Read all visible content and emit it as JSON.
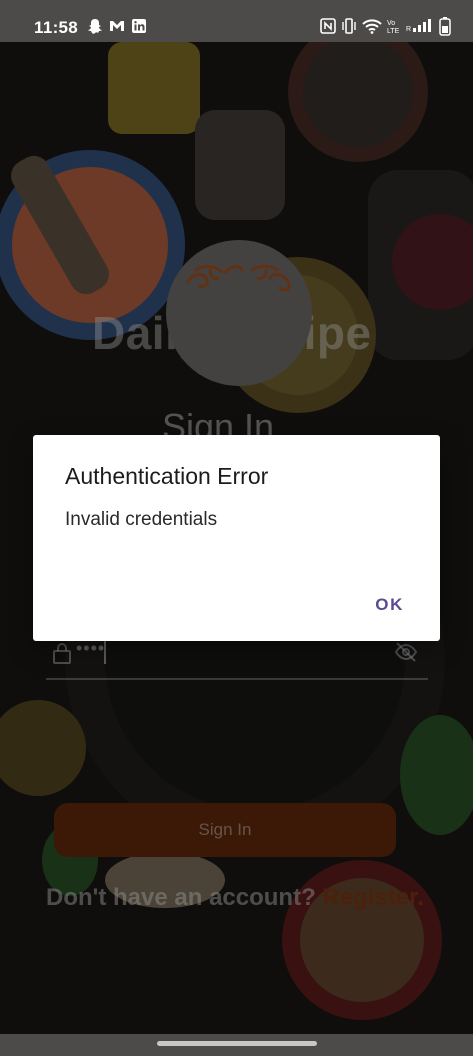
{
  "status_bar": {
    "time": "11:58",
    "left_icons": [
      "snapchat-icon",
      "gmail-icon",
      "linkedin-icon"
    ],
    "right_icons": [
      "nfc-icon",
      "vibrate-icon",
      "wifi-icon",
      "volte-icon",
      "signal-icon",
      "battery-icon"
    ]
  },
  "login": {
    "app_title": "Daily Recipe",
    "heading": "Sign In",
    "password_value": "••••",
    "signin_button": "Sign In",
    "register_prompt": "Don't have an account?",
    "register_link": "Register."
  },
  "dialog": {
    "title": "Authentication Error",
    "message": "Invalid credentials",
    "ok_button": "OK"
  },
  "colors": {
    "accent": "#5b4b8f",
    "brand_orange": "#c75a1c"
  }
}
